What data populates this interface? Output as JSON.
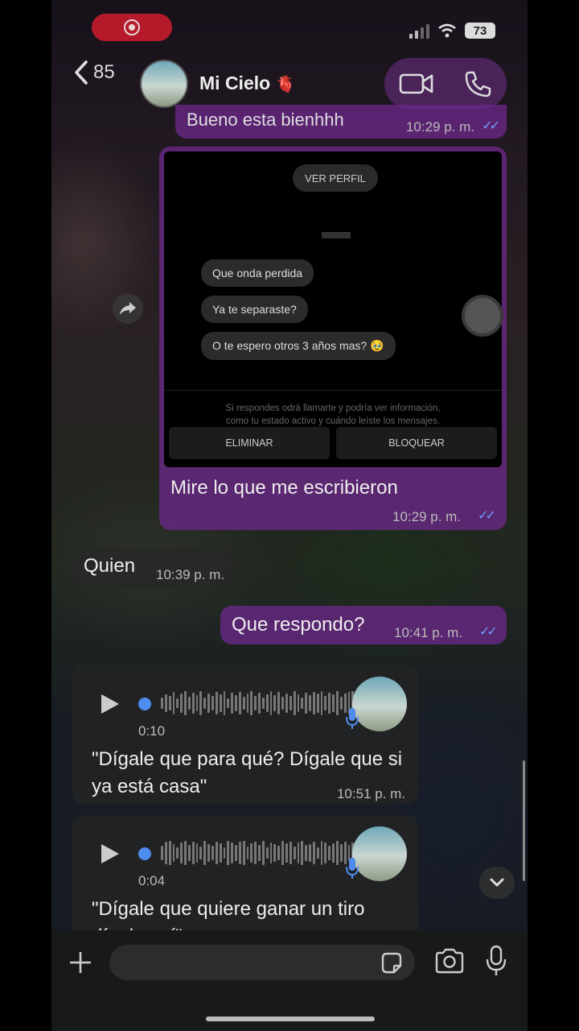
{
  "status": {
    "battery": "73"
  },
  "header": {
    "back_count": "85",
    "contact_name": "Mi Cielo",
    "contact_emoji": "🫀"
  },
  "messages": {
    "top_partial": {
      "text": "Bueno esta bienhhh",
      "time": "10:29 p. m."
    },
    "screenshot": {
      "ver_perfil": "VER PERFIL",
      "msg1": "Que onda perdida",
      "msg2": "Ya te separaste?",
      "msg3": "O te espero otros 3 años mas? 🥹",
      "note_line1": "Si respondes                    odrá llamarte y podría ver información,",
      "note_line2": "como tu estado activo y cuándo leíste los mensajes.",
      "btn_delete": "ELIMINAR",
      "btn_block": "BLOQUEAR"
    },
    "caption": {
      "text": "Mire lo que me escribieron",
      "time": "10:29 p. m."
    },
    "quien": {
      "text": "Quien",
      "time": "10:39 p. m."
    },
    "respondo": {
      "text": "Que respondo?",
      "time": "10:41 p. m."
    },
    "voice1": {
      "duration": "0:10",
      "transcript": "\"Dígale que para qué? Dígale que si ya está casa\"",
      "time": "10:51 p. m."
    },
    "voice2": {
      "duration": "0:04",
      "transcript": "\"Dígale que quiere ganar un tiro dígale así\""
    }
  },
  "colors": {
    "outgoing": "#6e288c",
    "read_ticks": "#6ea0ff",
    "record": "#b51a2a"
  }
}
